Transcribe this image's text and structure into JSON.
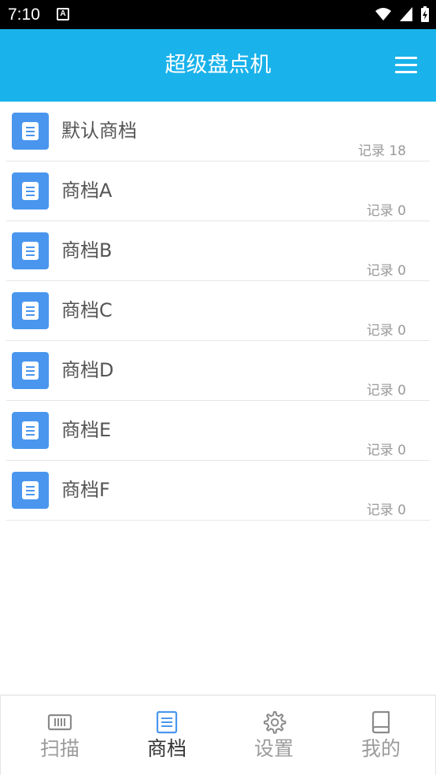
{
  "status_bar": {
    "time": "7:10",
    "notification_badge": "A"
  },
  "app_bar": {
    "title": "超级盘点机",
    "menu_icon": "menu-icon"
  },
  "colors": {
    "primary": "#19b2eb",
    "item_icon": "#4a96ee",
    "active_nav": "#4a96ee",
    "inactive_nav": "#9b9b9b"
  },
  "stores": [
    {
      "name": "默认商档",
      "count": "记录 18"
    },
    {
      "name": "商档A",
      "count": "记录 0"
    },
    {
      "name": "商档B",
      "count": "记录 0"
    },
    {
      "name": "商档C",
      "count": "记录 0"
    },
    {
      "name": "商档D",
      "count": "记录 0"
    },
    {
      "name": "商档E",
      "count": "记录 0"
    },
    {
      "name": "商档F",
      "count": "记录 0"
    }
  ],
  "bottom_nav": {
    "active": "商档",
    "items": [
      {
        "label": "扫描",
        "icon": "barcode-icon"
      },
      {
        "label": "商档",
        "icon": "document-list-icon"
      },
      {
        "label": "设置",
        "icon": "gear-icon"
      },
      {
        "label": "我的",
        "icon": "book-icon"
      }
    ]
  }
}
